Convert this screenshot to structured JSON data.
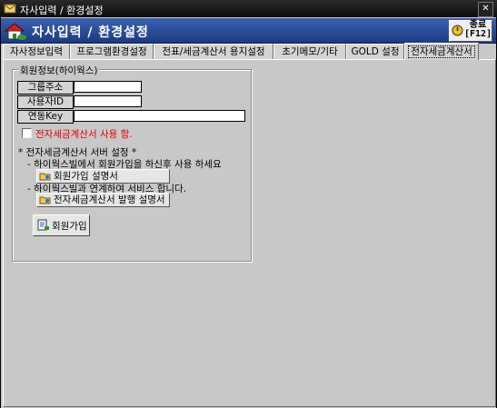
{
  "window": {
    "title": "자사입력 / 환경설정",
    "close_glyph": "✕"
  },
  "header": {
    "title": "자사입력 / 환경설정",
    "exit_label_line1": "종료",
    "exit_label_line2": "[F12]"
  },
  "tabs": [
    {
      "label": "자사정보입력"
    },
    {
      "label": "프로그램환경설정"
    },
    {
      "label": "전표/세금계산서 용지설정"
    },
    {
      "label": "초기메모/기타"
    },
    {
      "label": "GOLD 설정"
    },
    {
      "label": "전자세금계산서",
      "active": true
    }
  ],
  "member_group": {
    "title": "회원정보(하이웍스)",
    "fields": {
      "group_address": {
        "label": "그룹주소",
        "value": ""
      },
      "user_id": {
        "label": "사용자ID",
        "value": ""
      },
      "link_key": {
        "label": "연동Key",
        "value": ""
      }
    },
    "use_einvoice_label": "전자세금계산서 사용 함.",
    "use_einvoice_checked": false,
    "server_setting_title": "* 전자세금계산서 서버 설정 *",
    "note_join": "- 하이웍스빌에서 회원가입을 하신후 사용 하세요",
    "join_guide_button": "회원가입 설명서",
    "note_service": "- 하이웍스빌과 연계하여 서비스 합니다.",
    "issue_guide_button": "전자세금계산서 발행 설명서",
    "join_button": "회원가입"
  },
  "colors": {
    "header_bg": "#2a4a99",
    "warning_text": "#e00000",
    "panel_bg": "#c8c8c8"
  },
  "icons": [
    "app-icon",
    "house-logo-icon",
    "exit-power-icon",
    "document-folder-icon",
    "join-form-icon"
  ]
}
